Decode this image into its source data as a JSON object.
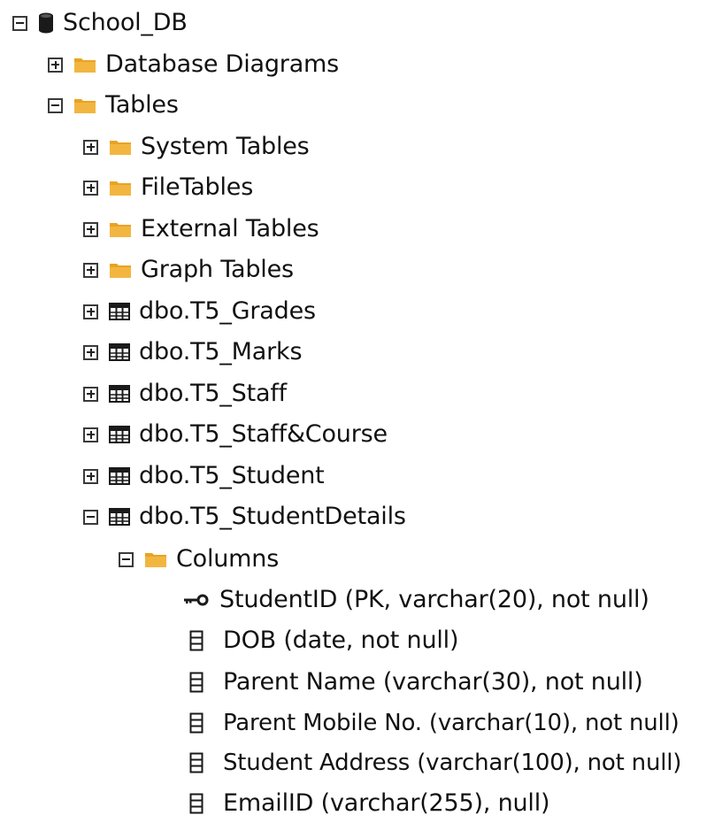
{
  "tree": {
    "root": {
      "label": "School_DB",
      "icon": "database-icon"
    },
    "database_diagrams": {
      "label": "Database Diagrams",
      "icon": "folder-icon"
    },
    "tables": {
      "label": "Tables",
      "icon": "folder-icon",
      "folders": [
        {
          "label": "System Tables",
          "icon": "folder-icon"
        },
        {
          "label": "FileTables",
          "icon": "folder-icon"
        },
        {
          "label": "External Tables",
          "icon": "folder-icon"
        },
        {
          "label": "Graph Tables",
          "icon": "folder-icon"
        }
      ],
      "items": [
        {
          "label": "dbo.T5_Grades",
          "icon": "table-icon"
        },
        {
          "label": "dbo.T5_Marks",
          "icon": "table-icon"
        },
        {
          "label": "dbo.T5_Staff",
          "icon": "table-icon"
        },
        {
          "label": "dbo.T5_Staff&Course",
          "icon": "table-icon"
        },
        {
          "label": "dbo.T5_Student",
          "icon": "table-icon"
        },
        {
          "label": "dbo.T5_StudentDetails",
          "icon": "table-icon"
        }
      ]
    },
    "columns_folder": {
      "label": "Columns",
      "icon": "folder-icon"
    },
    "columns": [
      {
        "label": "StudentID (PK, varchar(20), not null)",
        "icon": "key-icon"
      },
      {
        "label": "DOB (date, not null)",
        "icon": "column-icon"
      },
      {
        "label": "Parent Name (varchar(30), not null)",
        "icon": "column-icon"
      },
      {
        "label": "Parent Mobile No. (varchar(10), not null)",
        "icon": "column-icon"
      },
      {
        "label": "Student Address (varchar(100), not null)",
        "icon": "column-icon"
      },
      {
        "label": "EmailID (varchar(255), null)",
        "icon": "column-icon"
      }
    ]
  },
  "colors": {
    "folder": "#f2b640",
    "folder_tab": "#e9a323",
    "text": "#111111",
    "icon_dark": "#1a1a1a"
  }
}
